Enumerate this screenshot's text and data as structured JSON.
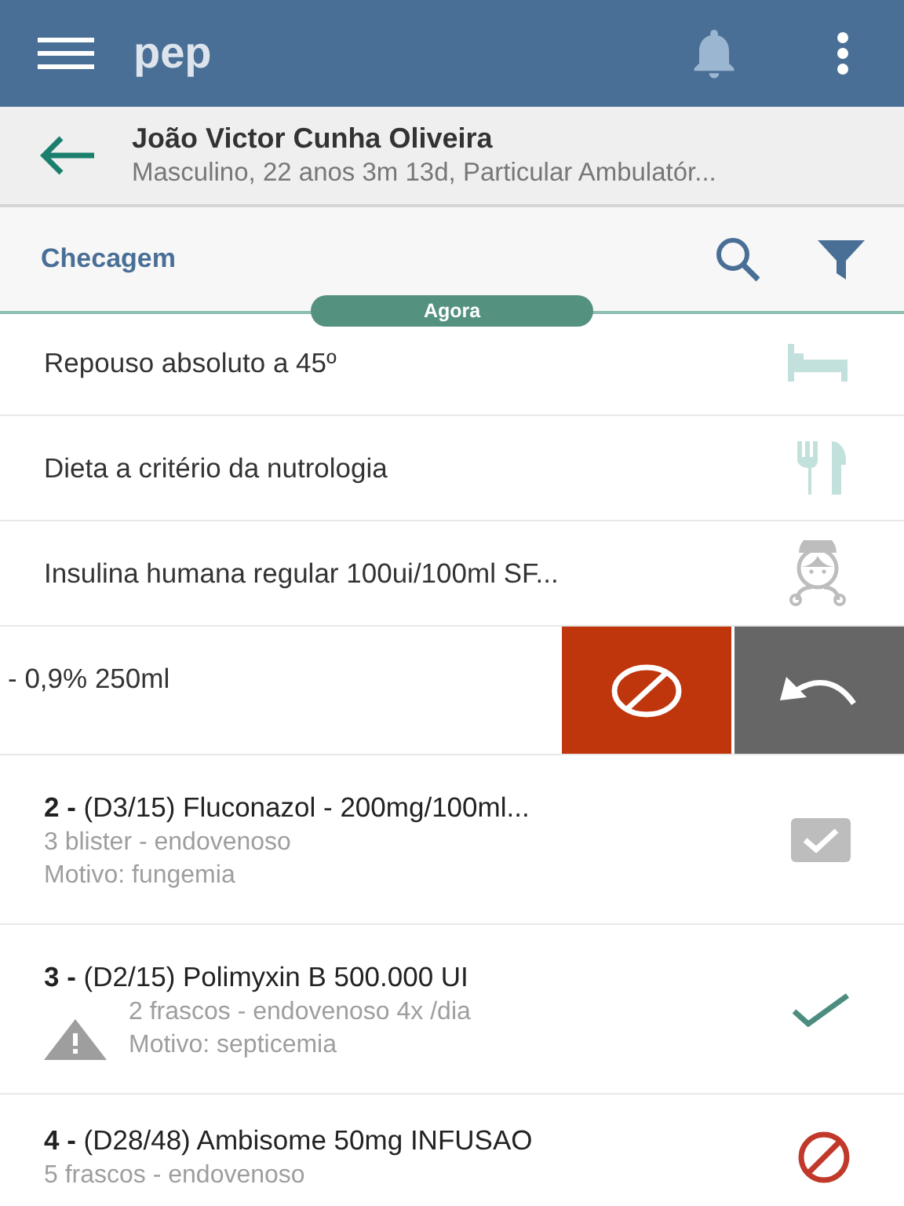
{
  "app_bar": {
    "title": "pep"
  },
  "patient": {
    "name": "João Victor Cunha Oliveira",
    "details": "Masculino, 22 anos 3m 13d, Particular Ambulatór..."
  },
  "toolbar": {
    "title": "Checagem"
  },
  "time_marker": "Agora",
  "orders": [
    {
      "kind": "bed",
      "text": "Repouso absoluto a 45º"
    },
    {
      "kind": "diet",
      "text": "Dieta a critério da nutrologia"
    },
    {
      "kind": "nurse",
      "text": "Insulina humana regular 100ui/100ml SF..."
    },
    {
      "kind": "swiped",
      "text": "- 0,9% 250ml"
    },
    {
      "kind": "administered",
      "title": "**2 -** (D3/15) Fluconazol - 200mg/100ml...",
      "lines": [
        "3 blister - endovenoso",
        "Motivo: fungemia"
      ],
      "warning": false
    },
    {
      "kind": "checked",
      "title": "**3 -** (D2/15) Polimyxin B 500.000 UI",
      "lines": [
        "2 frascos - endovenoso 4x /dia",
        "Motivo: septicemia"
      ],
      "warning": true
    },
    {
      "kind": "suspended",
      "title": "**4 -** (D28/48) Ambisome 50mg INFUSAO",
      "lines": [
        "5 frascos - endovenoso"
      ],
      "warning": false
    }
  ]
}
